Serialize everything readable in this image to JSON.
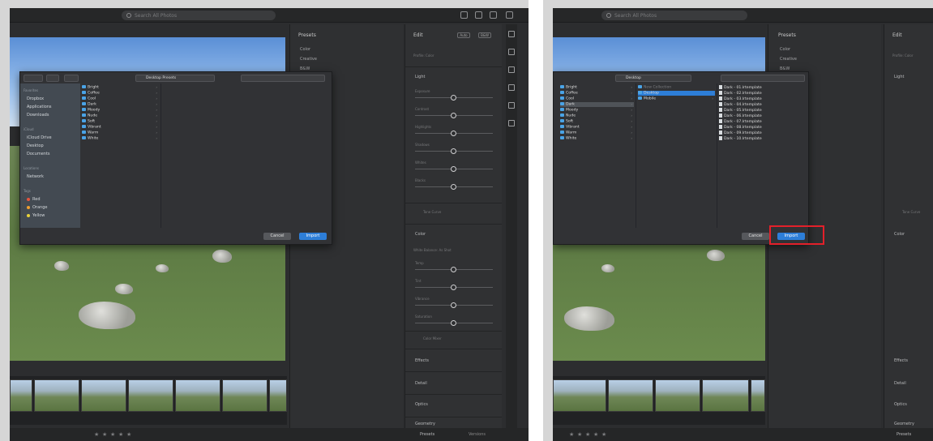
{
  "colors": {
    "accent": "#2d7ed8",
    "highlight": "#e3202a",
    "folder": "#4aa3e6"
  },
  "left": {
    "search_placeholder": "Search All Photos",
    "presets": {
      "title": "Presets",
      "items": [
        "Color",
        "Creative",
        "B&W"
      ]
    },
    "edit": {
      "title": "Edit",
      "auto": "Auto",
      "bw": "B&W",
      "profile": "Profile: Color",
      "light": {
        "title": "Light",
        "sliders": [
          "Exposure",
          "Contrast",
          "Highlights",
          "Shadows",
          "Whites",
          "Blacks"
        ]
      },
      "tone_curve": "Tone Curve",
      "color": {
        "title": "Color",
        "wb": "White Balance: As Shot",
        "sliders": [
          "Temp",
          "Tint",
          "Vibrance",
          "Saturation"
        ]
      },
      "color_mixer": "Color Mixer",
      "sections": [
        "Effects",
        "Detail",
        "Optics",
        "Geometry"
      ]
    },
    "footer": {
      "presets": "Presets",
      "versions": "Versions"
    },
    "dialog": {
      "location": "Desktop Presets",
      "sidebar": {
        "favorites_header": "Favorites",
        "favorites": [
          "Dropbox",
          "Applications",
          "Downloads"
        ],
        "icloud_header": "iCloud",
        "icloud": [
          "iCloud Drive",
          "Desktop",
          "Documents"
        ],
        "locations_header": "Locations",
        "locations": [
          "Network"
        ],
        "tags_header": "Tags",
        "tags": [
          {
            "label": "Red",
            "color": "#e5553f"
          },
          {
            "label": "Orange",
            "color": "#f0a030"
          },
          {
            "label": "Yellow",
            "color": "#e9d23a"
          }
        ]
      },
      "folders": [
        "Bright",
        "Coffee",
        "Cool",
        "Dark",
        "Moody",
        "Nude",
        "Soft",
        "Vibrant",
        "Warm",
        "White"
      ],
      "cancel": "Cancel",
      "import": "Import"
    }
  },
  "right": {
    "search_placeholder": "Search All Photos",
    "presets": {
      "title": "Presets",
      "items": [
        "Color",
        "Creative",
        "B&W"
      ]
    },
    "edit": {
      "title": "Edit",
      "profile": "Profile: Color",
      "light": "Light",
      "tone_curve": "Tone Curve",
      "color": "Color",
      "sections": [
        "Effects",
        "Detail",
        "Optics",
        "Geometry"
      ]
    },
    "footer": {
      "presets": "Presets"
    },
    "dialog": {
      "location": "Desktop",
      "folders": [
        "Bright",
        "Coffee",
        "Cool",
        "Dark",
        "Moody",
        "Nude",
        "Soft",
        "Vibrant",
        "Warm",
        "White"
      ],
      "sub_folders": [
        "New Collection",
        "Desktop",
        "Mobile"
      ],
      "files": [
        "Dark - 01.lrtemplate",
        "Dark - 02.lrtemplate",
        "Dark - 03.lrtemplate",
        "Dark - 04.lrtemplate",
        "Dark - 05.lrtemplate",
        "Dark - 06.lrtemplate",
        "Dark - 07.lrtemplate",
        "Dark - 08.lrtemplate",
        "Dark - 09.lrtemplate",
        "Dark - 10.lrtemplate"
      ],
      "cancel": "Cancel",
      "import": "Import"
    }
  }
}
